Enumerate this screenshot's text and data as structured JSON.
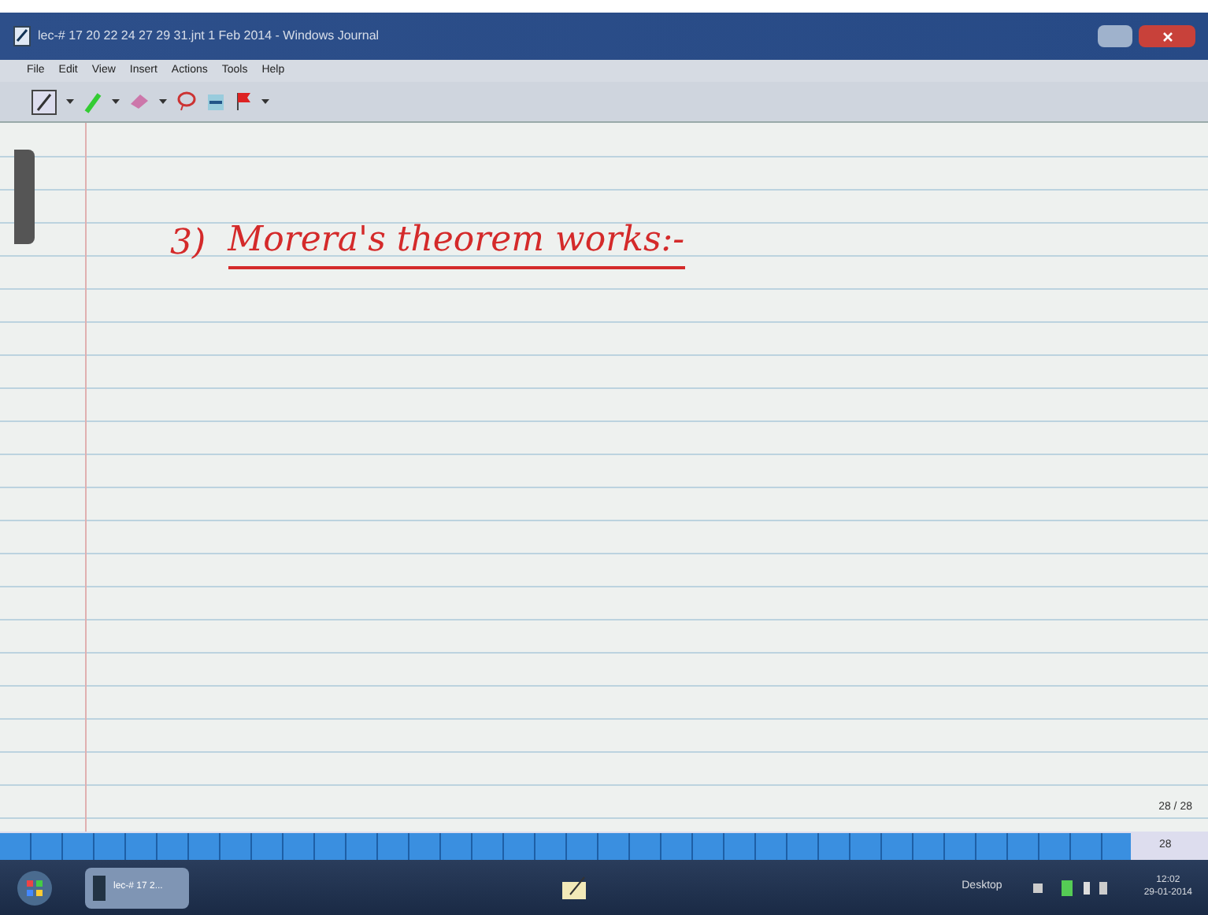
{
  "window": {
    "title": "lec-# 17 20 22 24 27 29 31.jnt 1 Feb 2014 - Windows Journal"
  },
  "menu": [
    "File",
    "Edit",
    "View",
    "Insert",
    "Actions",
    "Tools",
    "Help"
  ],
  "note": {
    "number": "3)",
    "heading": "Morera's theorem works:-"
  },
  "page_indicator": "28 / 28",
  "page_bar": {
    "current": "28"
  },
  "taskbar": {
    "task": "lec-# 17 2...",
    "tray_label": "Desktop",
    "time": "12:02",
    "date": "29-01-2014"
  }
}
